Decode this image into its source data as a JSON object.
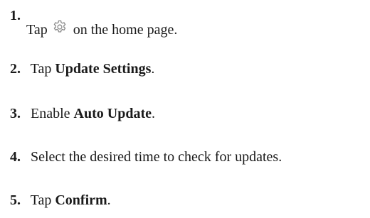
{
  "steps": [
    {
      "number": "1.",
      "before": "Tap",
      "icon": "gear-icon",
      "after": "on the home page."
    },
    {
      "number": "2.",
      "before": "Tap",
      "bold": "Update Settings",
      "after": "."
    },
    {
      "number": "3.",
      "before": "Enable",
      "bold": "Auto Update",
      "after": "."
    },
    {
      "number": "4.",
      "before": "Select the desired time to check for updates."
    },
    {
      "number": "5.",
      "before": "Tap",
      "bold": "Confirm",
      "after": "."
    }
  ],
  "colors": {
    "text": "#1a1a1a",
    "icon": "#8a8a8a"
  }
}
